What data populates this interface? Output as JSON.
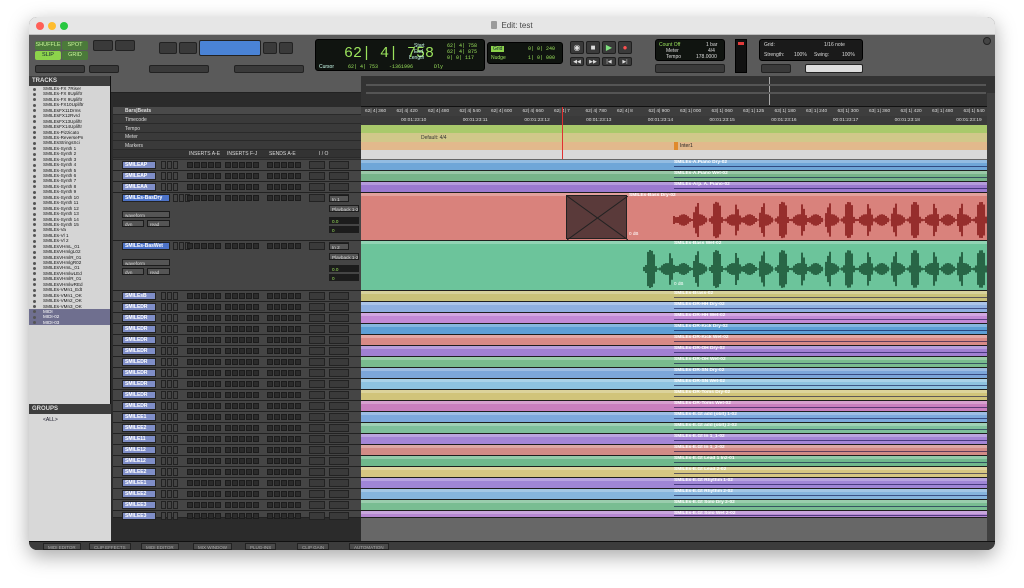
{
  "window": {
    "title": "Edit: test"
  },
  "toolbar": {
    "modes": [
      "SHUFFLE",
      "SPOT",
      "SLIP",
      "GRID"
    ],
    "counter": {
      "main": "62| 4| 758",
      "start_label": "Start",
      "start": "62| 4| 758",
      "end_label": "End",
      "end": "62| 4| 875",
      "length_label": "Length",
      "length": "0| 0| 117",
      "cursor_label": "Cursor",
      "cursor": "62| 4| 753",
      "sample": "-1361996",
      "dly": "Dly"
    },
    "grid_btn": "Grid",
    "grid_value": "0| 0| 240",
    "nudge_btn": "Nudge",
    "nudge_value": "1| 0| 000",
    "count_off": "Count Off",
    "count_bars": "1 bar",
    "meter_label": "Meter",
    "meter_value": "4/4",
    "tempo_label": "Tempo",
    "tempo_value": "178.0000",
    "grid_label": "Grid:",
    "grid_note": "1/16 note",
    "strength_label": "Strength:",
    "strength_value": "100%",
    "swing_label": "Swing:",
    "swing_value": "100%"
  },
  "tracks_panel": {
    "title": "TRACKS",
    "items": [
      "SMILEs-FX 7Riser",
      "SMILEs-FX 8Upliftr",
      "SMILEs-FX 9Upliftr",
      "SMILEs-FX10Upliftr",
      "SMILEsFX11Drms",
      "SMILEsFX12Rvrd",
      "SMILEsFX13Upliftr",
      "SMILEsFX14Upliftr",
      "SMILEs-Pizzicato",
      "SMILEs-ReversePn",
      "SMILEsStringsSci",
      "SMILEs-Synth 1",
      "SMILEs-Synth 2",
      "SMILEs-Synth 3",
      "SMILEs-Synth 4",
      "SMILEs-Synth 5",
      "SMILEs-Synth 6",
      "SMILEs-Synth 7",
      "SMILEs-Synth 8",
      "SMILEs-Synth 9",
      "SMILEs-Synth 10",
      "SMILEs-Synth 11",
      "SMILEs-Synth 12",
      "SMILEs-Synth 13",
      "SMILEs-Synth 14",
      "SMILEs-Synth 15",
      "SMILEs-Va",
      "SMILEs-Vl 1",
      "SMILEs-Vl 2",
      "SMILEsVHmL_01",
      "SMILEsVHmlgL02",
      "SMILEsVHmlR_01",
      "SMILEsVHmlgR02",
      "SMILEsVHmL_01",
      "SMILEsVHmlwLEd",
      "SMILEsVHmlR_01",
      "SMILEsVHmlwREd",
      "SMILEs-VMn1_Edt",
      "SMILEs-VMn1_OK",
      "SMILEs-VMn2_OK",
      "SMILEs-VMn3_OK",
      "MIDI",
      "MIDI-02",
      "MIDI-03"
    ],
    "groups_title": "GROUPS",
    "groups_item": "<ALL>"
  },
  "track_header": {
    "inserts_ae": "INSERTS A-E",
    "inserts_fj": "INSERTS F-J",
    "sends_ae": "SENDS A-E",
    "io": "I / O"
  },
  "rulers": {
    "bars_label": "Bars|Beats",
    "timecode_label": "Timecode",
    "tempo_label": "Tempo",
    "meter_label": "Meter",
    "markers_label": "Markers",
    "bars_ticks": [
      "62| 4| 360",
      "62| 4| 420",
      "62| 4| 480",
      "62| 4| 540",
      "62| 4| 600",
      "62| 4| 660",
      "62| 4| 7",
      "62| 4| 780",
      "62| 4| 8",
      "62| 4| 900",
      "63| 1| 000",
      "63| 1| 060",
      "63| 1| 125",
      "63| 1| 180",
      "63| 1| 240",
      "63| 1| 300",
      "63| 1| 360",
      "63| 1| 420",
      "63| 1| 480",
      "63| 1| 540"
    ],
    "tc_ticks": [
      "00:01:23:10",
      "00:01:23:11",
      "00:01:23:12",
      "00:01:23:13",
      "00:01:23:14",
      "00:01:23:15",
      "00:01:23:16",
      "00:01:23:17",
      "00:01:23:18",
      "00:01:23:19"
    ],
    "meter_text": "Default: 4/4",
    "marker_text": "Inter1"
  },
  "track_rows": [
    {
      "name": "SMILEAP",
      "clip": "SMILEs-A.Piano Dry-02",
      "color": "#6fa6d8",
      "height": 11
    },
    {
      "name": "SMILEAP",
      "clip": "SMILEs-A.Piano Wet-02",
      "color": "#77b48a",
      "height": 11
    },
    {
      "name": "SMILEAA",
      "clip": "SMILEs-Arp. A. Piano-02",
      "color": "#9b7ad0",
      "height": 11
    },
    {
      "name": "SMILEs-BasDry",
      "clip": "SMILEs-Bass Dry-02",
      "color": "#d9827c",
      "height": 48,
      "big": true,
      "view": "waveform",
      "dyn": "dyn",
      "read": "read",
      "input": "In 1",
      "output": "Playback 1-2",
      "vol": "0.0",
      "pan": "0",
      "clip_gain": "0 dB"
    },
    {
      "name": "SMILEs-BasWet",
      "clip": "SMILEs-Bass Wet-02",
      "color": "#6cc49b",
      "height": 50,
      "big": true,
      "view": "waveform",
      "dyn": "dyn",
      "read": "read",
      "input": "In 2",
      "output": "Playback 1-2",
      "vol": "0.0",
      "pan": "0",
      "clip_gain": "0 dB"
    },
    {
      "name": "SMILEsB",
      "clip": "SMILEs-Brass-02",
      "color": "#c9c27a",
      "height": 11
    },
    {
      "name": "SMILEDR",
      "clip": "SMILEs-DR-HH Dry-02",
      "color": "#8fb0e0",
      "height": 11
    },
    {
      "name": "SMILEDR",
      "clip": "SMILEs-DR-HH Wet-02",
      "color": "#c28ad6",
      "height": 11
    },
    {
      "name": "SMILEDR",
      "clip": "SMILEs-DR-Kick Dry-02",
      "color": "#5d9fd6",
      "height": 11
    },
    {
      "name": "SMILEDR",
      "clip": "SMILEs-DR-Kick Wet-02",
      "color": "#d88a86",
      "height": 11
    },
    {
      "name": "SMILEDR",
      "clip": "SMILEs-DR-OH Dry-02",
      "color": "#a17fd2",
      "height": 11
    },
    {
      "name": "SMILEDR",
      "clip": "SMILEs-DR-OH Wet-02",
      "color": "#79bb8e",
      "height": 11
    },
    {
      "name": "SMILEDR",
      "clip": "SMILEs-DR-SN Dry-02",
      "color": "#7ca6d9",
      "height": 11
    },
    {
      "name": "SMILEDR",
      "clip": "SMILEs-DR-SN Wet-02",
      "color": "#8ec3e0",
      "height": 11
    },
    {
      "name": "SMILEDR",
      "clip": "SMILEs-DR-Toms Dry-02",
      "color": "#d1c47a",
      "height": 11
    },
    {
      "name": "SMILEDR",
      "clip": "SMILEs-DR-Toms Wet-02",
      "color": "#c97fbf",
      "height": 11
    },
    {
      "name": "SMILEE1",
      "clip": "SMILEs-E.Gt add (oblt) 1-02",
      "color": "#7da9dd",
      "height": 11
    },
    {
      "name": "SMILEE2",
      "clip": "SMILEs-E.Gt add (oblt) 2-02",
      "color": "#7fc09c",
      "height": 11
    },
    {
      "name": "SMILE11",
      "clip": "SMILEs-E.Gt In 1_1-02",
      "color": "#a486d6",
      "height": 11
    },
    {
      "name": "SMILE12",
      "clip": "SMILEs-E.Gt In 1_2-02",
      "color": "#d28b86",
      "height": 11
    },
    {
      "name": "SMILE12",
      "clip": "SMILEs-E.Gt Lead 1 In2-01",
      "color": "#6fb88c",
      "height": 11
    },
    {
      "name": "SMILEE2",
      "clip": "SMILEs-E.Gt Lead 2-02",
      "color": "#d6c782",
      "height": 11
    },
    {
      "name": "SMILEE1",
      "clip": "SMILEs-E.Gt Rhythm 1-02",
      "color": "#9f86d6",
      "height": 11
    },
    {
      "name": "SMILEE2",
      "clip": "SMILEs-E.Gt Rhythm 2-02",
      "color": "#86b5dd",
      "height": 11
    },
    {
      "name": "SMILEE3",
      "clip": "SMILEs-E.Gt Solo Dry 2-02",
      "color": "#79bd92",
      "height": 11
    },
    {
      "name": "SMILEE3",
      "clip": "SMILEs-E.Gt Solo Wet 2-02",
      "color": "#b688d2",
      "height": 7
    }
  ],
  "bottom_tabs": [
    "MIDI EDITOR",
    "CLIP EFFECTS",
    "MIDI EDITOR",
    "MIX WINDOW",
    "PLUG-INS",
    "CLIP GAIN",
    "AUTOMATION"
  ]
}
